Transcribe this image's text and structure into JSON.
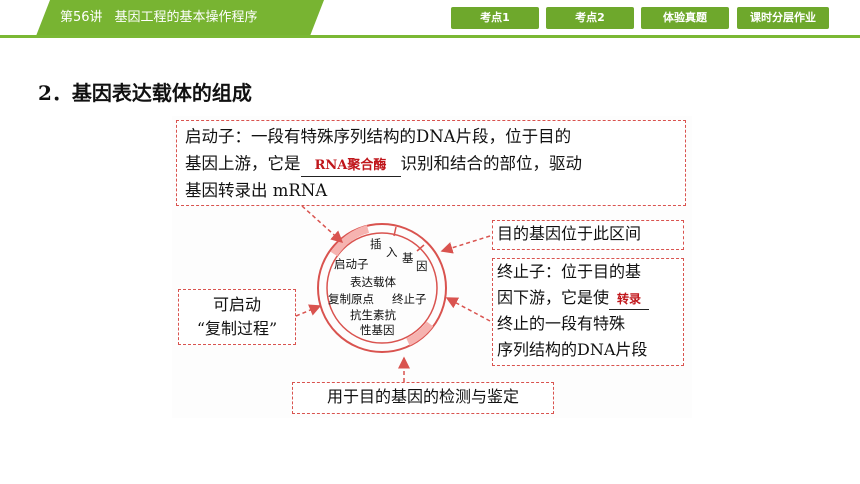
{
  "header": {
    "lecture": "第56讲",
    "title": "基因工程的基本操作程序",
    "tabs": [
      "考点1",
      "考点2",
      "体验真题",
      "课时分层作业"
    ]
  },
  "heading": "2．基因表达载体的组成",
  "figure": {
    "promoter_box": {
      "line1": "启动子：一段有特殊序列结构的DNA片段，位于目的",
      "line2_prefix": "基因上游，它是",
      "blank": "RNA聚合酶",
      "line2_suffix": "识别和结合的部位，驱动",
      "line3": "基因转录出 mRNA"
    },
    "target_gene_box": "目的基因位于此区间",
    "terminator_box": {
      "line1": "终止子：位于目的基",
      "line2_prefix": "因下游，它是使",
      "blank": "转录",
      "line3": "终止的一段有特殊",
      "line4": "序列结构的DNA片段"
    },
    "origin_box": {
      "line1": "可启动",
      "line2": "“复制过程”"
    },
    "marker_box": "用于目的基因的检测与鉴定",
    "plasmid_labels": {
      "insert_1": "插",
      "insert_2": "入",
      "insert_3": "基",
      "insert_4": "因",
      "promoter": "启动子",
      "vector": "表达载体",
      "origin": "复制原点",
      "terminator": "终止子",
      "marker_1": "抗生素抗",
      "marker_2": "性基因"
    }
  }
}
